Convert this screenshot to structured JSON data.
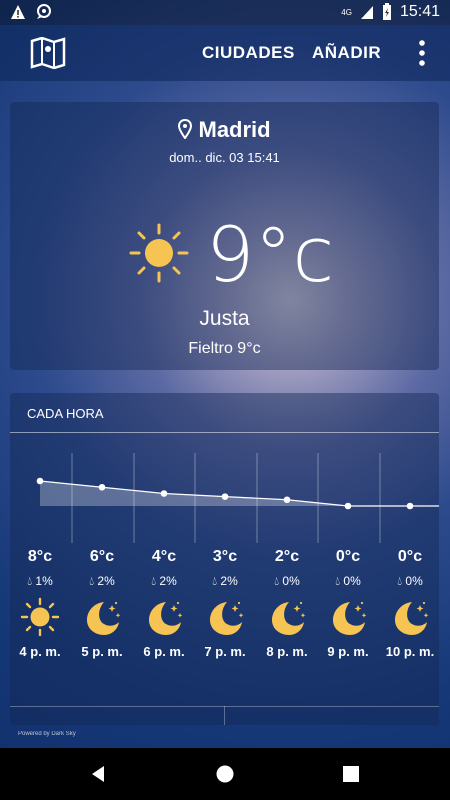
{
  "status": {
    "time": "15:41",
    "network": "4G"
  },
  "appbar": {
    "nav_cities": "CIUDADES",
    "nav_add": "AÑADIR"
  },
  "current": {
    "city": "Madrid",
    "datetime": "dom.. dic. 03 15:41",
    "temp": "9°c",
    "condition": "Justa",
    "feels_like": "Fieltro 9°c",
    "icon": "sun-icon"
  },
  "hourly": {
    "title": "CADA HORA",
    "items": [
      {
        "temp": "8°c",
        "precip": "1%",
        "hour": "4 p. m.",
        "icon": "sun-icon"
      },
      {
        "temp": "6°c",
        "precip": "2%",
        "hour": "5 p. m.",
        "icon": "moon-stars-icon"
      },
      {
        "temp": "4°c",
        "precip": "2%",
        "hour": "6 p. m.",
        "icon": "moon-stars-icon"
      },
      {
        "temp": "3°c",
        "precip": "2%",
        "hour": "7 p. m.",
        "icon": "moon-stars-icon"
      },
      {
        "temp": "2°c",
        "precip": "0%",
        "hour": "8 p. m.",
        "icon": "moon-stars-icon"
      },
      {
        "temp": "0°c",
        "precip": "0%",
        "hour": "9 p. m.",
        "icon": "moon-stars-icon"
      },
      {
        "temp": "0°c",
        "precip": "0%",
        "hour": "10 p. m.",
        "icon": "moon-stars-icon"
      }
    ]
  },
  "footer": {
    "powered": "Powered by Dark Sky"
  },
  "colors": {
    "sun": "#f6c453",
    "moon": "#f6c453",
    "accent": "#ffffff"
  }
}
